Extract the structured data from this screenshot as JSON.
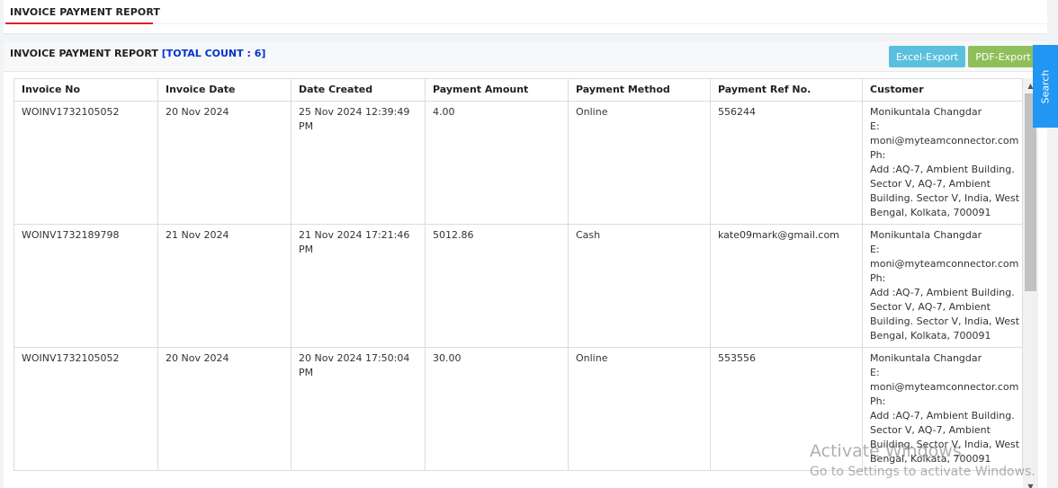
{
  "page": {
    "title": "INVOICE PAYMENT REPORT"
  },
  "panel": {
    "title": "INVOICE PAYMENT REPORT",
    "count_label": "[TOTAL COUNT : 6]"
  },
  "toolbar": {
    "excel_label": "Excel-Export",
    "pdf_label": "PDF-Export"
  },
  "side": {
    "search_label": "Search"
  },
  "table": {
    "headers": [
      "Invoice No",
      "Invoice Date",
      "Date Created",
      "Payment Amount",
      "Payment Method",
      "Payment Ref No.",
      "Customer"
    ],
    "rows": [
      {
        "invoice_no": "WOINV1732105052",
        "invoice_date": "20 Nov 2024",
        "date_created": "25 Nov 2024 12:39:49 PM",
        "amount": "4.00",
        "method": "Online",
        "ref": "556244",
        "customer": [
          "Monikuntala Changdar",
          "E:",
          "moni@myteamconnector.com",
          "Ph:",
          "Add :AQ-7, Ambient Building.",
          "Sector V, AQ-7, Ambient",
          "Building. Sector V, India, West",
          "Bengal, Kolkata, 700091"
        ]
      },
      {
        "invoice_no": "WOINV1732189798",
        "invoice_date": "21 Nov 2024",
        "date_created": "21 Nov 2024 17:21:46 PM",
        "amount": "5012.86",
        "method": "Cash",
        "ref": "kate09mark@gmail.com",
        "customer": [
          "Monikuntala Changdar",
          "E:",
          "moni@myteamconnector.com",
          "Ph:",
          "Add :AQ-7, Ambient Building.",
          "Sector V, AQ-7, Ambient",
          "Building. Sector V, India, West",
          "Bengal, Kolkata, 700091"
        ]
      },
      {
        "invoice_no": "WOINV1732105052",
        "invoice_date": "20 Nov 2024",
        "date_created": "20 Nov 2024 17:50:04 PM",
        "amount": "30.00",
        "method": "Online",
        "ref": "553556",
        "customer": [
          "Monikuntala Changdar",
          "E:",
          "moni@myteamconnector.com",
          "Ph:",
          "Add :AQ-7, Ambient Building.",
          "Sector V, AQ-7, Ambient",
          "Building. Sector V, India, West",
          "Bengal, Kolkata, 700091"
        ]
      }
    ]
  },
  "icons": {
    "scroll_up": "triangle-up-icon",
    "scroll_down": "triangle-down-icon"
  },
  "watermark": {
    "line1": "Activate Windows",
    "line2": "Go to Settings to activate Windows."
  },
  "colors": {
    "accent_underline": "#e02020",
    "count_text": "#0033cc",
    "excel_button": "#5bc0de",
    "pdf_button": "#8fbf5a",
    "search_tab": "#2196f3"
  }
}
